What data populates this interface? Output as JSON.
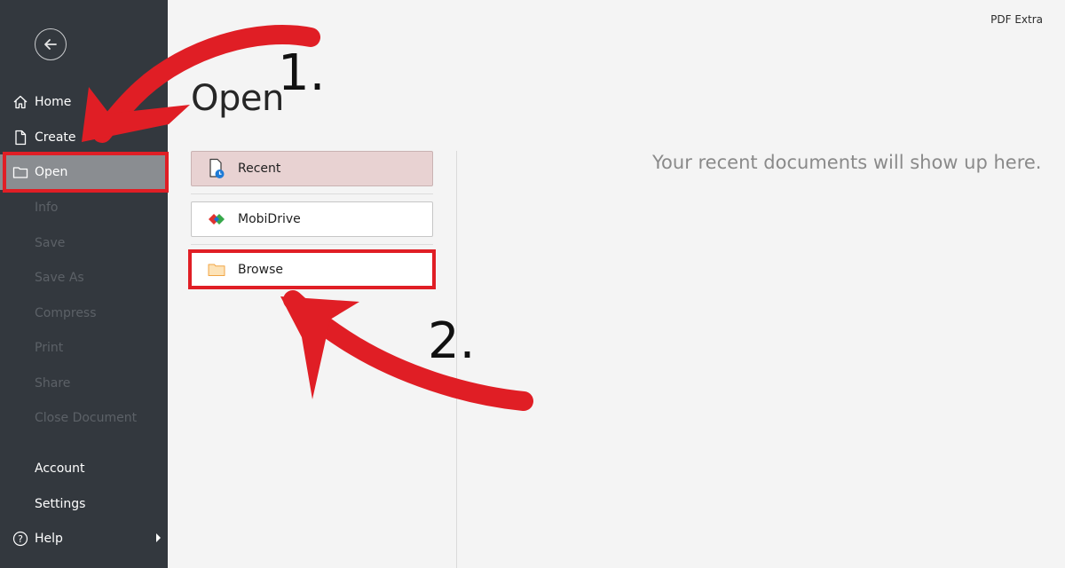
{
  "app": {
    "name": "PDF Extra"
  },
  "sidebar": {
    "back_icon": "arrow-left-icon",
    "items": [
      {
        "label": "Home",
        "icon": "home-icon",
        "state": "normal"
      },
      {
        "label": "Create",
        "icon": "document-icon",
        "state": "normal"
      },
      {
        "label": "Open",
        "icon": "folder-icon",
        "state": "selected"
      },
      {
        "label": "Info",
        "state": "disabled"
      },
      {
        "label": "Save",
        "state": "disabled"
      },
      {
        "label": "Save As",
        "state": "disabled"
      },
      {
        "label": "Compress",
        "state": "disabled"
      },
      {
        "label": "Print",
        "state": "disabled"
      },
      {
        "label": "Share",
        "state": "disabled"
      },
      {
        "label": "Close Document",
        "state": "disabled"
      },
      {
        "label": "Account",
        "state": "normal"
      },
      {
        "label": "Settings",
        "state": "normal"
      },
      {
        "label": "Help",
        "icon": "help-icon",
        "state": "normal",
        "submenu": true
      }
    ]
  },
  "main": {
    "title": "Open",
    "locations": [
      {
        "label": "Recent",
        "icon": "recent-document-icon",
        "selected": true
      },
      {
        "label": "MobiDrive",
        "icon": "mobidrive-logo-icon",
        "selected": false
      },
      {
        "label": "Browse",
        "icon": "folder-icon",
        "selected": false
      }
    ],
    "empty_message": "Your recent documents will show up here."
  },
  "annotations": {
    "step1": "1.",
    "step2": "2.",
    "color": "#e01e25"
  }
}
